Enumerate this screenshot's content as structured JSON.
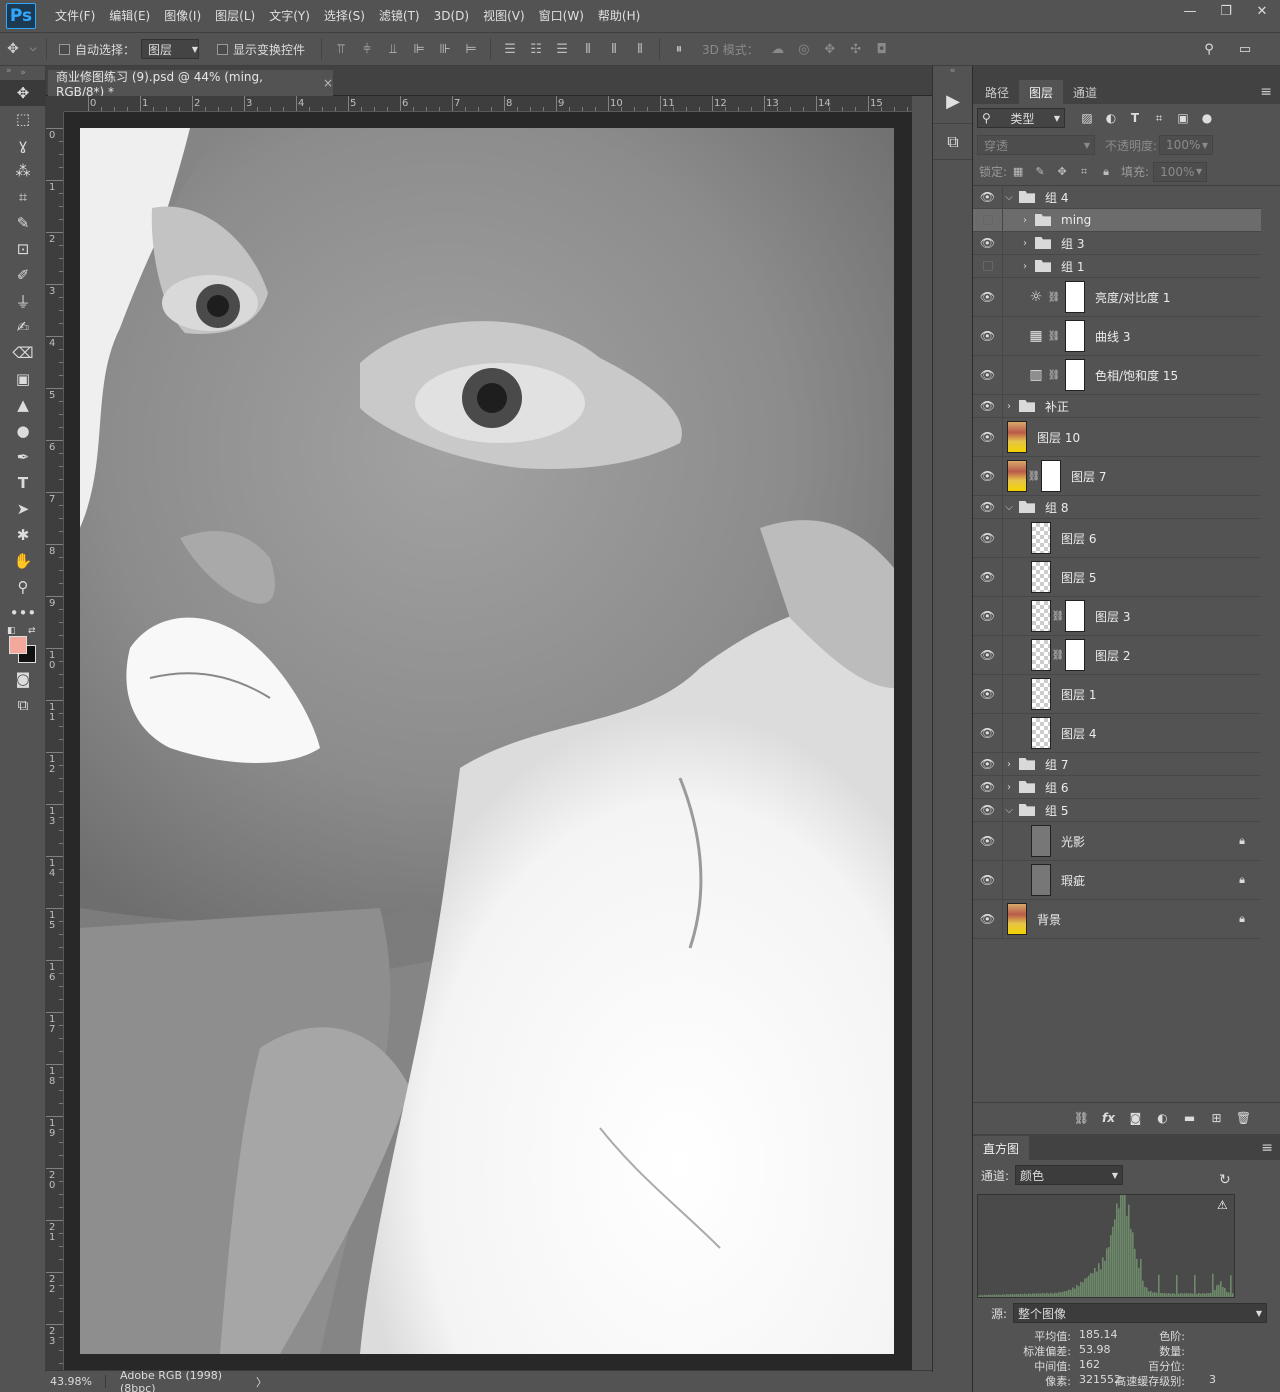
{
  "app": {
    "logo": "Ps",
    "menu": [
      "文件(F)",
      "编辑(E)",
      "图像(I)",
      "图层(L)",
      "文字(Y)",
      "选择(S)",
      "滤镜(T)",
      "3D(D)",
      "视图(V)",
      "窗口(W)",
      "帮助(H)"
    ],
    "window_controls": [
      "—",
      "❐",
      "✕"
    ]
  },
  "options_bar": {
    "auto_select_label": "自动选择：",
    "auto_select_value": "图层",
    "show_transform_label": "显示变换控件",
    "mode_3d_label": "3D 模式："
  },
  "document": {
    "tab_title": "商业修图练习 (9).psd @ 44% (ming, RGB/8*) *",
    "close": "×",
    "ruler_top_labels": [
      "0",
      "1",
      "2",
      "3",
      "4",
      "5",
      "6",
      "7",
      "8",
      "9",
      "10",
      "11",
      "12",
      "13",
      "14",
      "15"
    ],
    "ruler_left_labels": [
      "0",
      "1",
      "2",
      "3",
      "4",
      "5",
      "6",
      "7",
      "8",
      "9",
      "10",
      "11",
      "12",
      "13",
      "14",
      "15",
      "16",
      "17",
      "18",
      "19",
      "20",
      "21",
      "22",
      "23"
    ]
  },
  "status": {
    "zoom": "43.98%",
    "profile": "Adobe RGB (1998) (8bpc)",
    "arrow": "〉"
  },
  "layers_panel": {
    "tabs": [
      "路径",
      "图层",
      "通道"
    ],
    "active_tab": "图层",
    "filter_kind": "类型",
    "blend_mode": "穿透",
    "opacity_label": "不透明度:",
    "opacity_value": "100%",
    "lock_label": "锁定:",
    "fill_label": "填充:",
    "fill_value": "100%",
    "layers": [
      {
        "name": "组 4",
        "kind": "group",
        "expanded": true,
        "indent": 0,
        "visible": true
      },
      {
        "name": "ming",
        "kind": "group",
        "expanded": false,
        "indent": 1,
        "visible": false,
        "selected": true
      },
      {
        "name": "组 3",
        "kind": "group",
        "expanded": false,
        "indent": 1,
        "visible": true
      },
      {
        "name": "组 1",
        "kind": "group",
        "expanded": false,
        "indent": 1,
        "visible": false
      },
      {
        "name": "亮度/对比度 1",
        "kind": "adjust",
        "icon": "☼",
        "indent": 1,
        "visible": true
      },
      {
        "name": "曲线 3",
        "kind": "adjust",
        "icon": "▦",
        "indent": 1,
        "visible": true
      },
      {
        "name": "色相/饱和度 15",
        "kind": "adjust",
        "icon": "▥",
        "indent": 1,
        "visible": true
      },
      {
        "name": "补正",
        "kind": "group",
        "expanded": false,
        "indent": 0,
        "visible": true
      },
      {
        "name": "图层 10",
        "kind": "pixel",
        "thumb": "portrait",
        "indent": 0,
        "visible": true
      },
      {
        "name": "图层 7",
        "kind": "pixel-mask",
        "thumb": "portrait",
        "indent": 0,
        "visible": true
      },
      {
        "name": "组 8",
        "kind": "group",
        "expanded": true,
        "indent": 0,
        "visible": true
      },
      {
        "name": "图层 6",
        "kind": "pixel",
        "thumb": "check",
        "indent": 1,
        "visible": true
      },
      {
        "name": "图层 5",
        "kind": "pixel",
        "thumb": "check",
        "indent": 1,
        "visible": true
      },
      {
        "name": "图层 3",
        "kind": "pixel-mask",
        "thumb": "check",
        "indent": 1,
        "visible": true
      },
      {
        "name": "图层 2",
        "kind": "pixel-mask",
        "thumb": "check",
        "indent": 1,
        "visible": true
      },
      {
        "name": "图层 1",
        "kind": "pixel",
        "thumb": "check",
        "indent": 1,
        "visible": true
      },
      {
        "name": "图层 4",
        "kind": "pixel",
        "thumb": "check",
        "indent": 1,
        "visible": true
      },
      {
        "name": "组 7",
        "kind": "group",
        "expanded": false,
        "indent": 0,
        "visible": true
      },
      {
        "name": "组 6",
        "kind": "group",
        "expanded": false,
        "indent": 0,
        "visible": true
      },
      {
        "name": "组 5",
        "kind": "group",
        "expanded": true,
        "indent": 0,
        "visible": true
      },
      {
        "name": "光影",
        "kind": "pixel",
        "thumb": "gray",
        "indent": 1,
        "visible": true,
        "locked": true
      },
      {
        "name": "瑕疵",
        "kind": "pixel",
        "thumb": "gray",
        "indent": 1,
        "visible": true,
        "locked": true
      },
      {
        "name": "背景",
        "kind": "pixel",
        "thumb": "portrait",
        "indent": 0,
        "visible": true,
        "locked": true
      }
    ],
    "footer_icons": [
      "link-icon",
      "fx-icon",
      "mask-icon",
      "adjustment-icon",
      "folder-icon",
      "new-layer-icon",
      "trash-icon"
    ]
  },
  "histogram": {
    "tab": "直方图",
    "channel_label": "通道:",
    "channel_value": "颜色",
    "source_label": "源:",
    "source_value": "整个图像",
    "stats": {
      "mean_label": "平均值:",
      "mean": "185.14",
      "std_label": "标准偏差:",
      "std": "53.98",
      "median_label": "中间值:",
      "median": "162",
      "pixels_label": "像素:",
      "pixels": "321552",
      "level_label": "色阶:",
      "count_label": "数量:",
      "percentile_label": "百分位:",
      "cache_label": "高速缓存级别:",
      "cache": "3"
    },
    "histogram_color": "#6d8a6a"
  },
  "colors": {
    "foreground": "#f2a99c",
    "background": "#111111"
  }
}
